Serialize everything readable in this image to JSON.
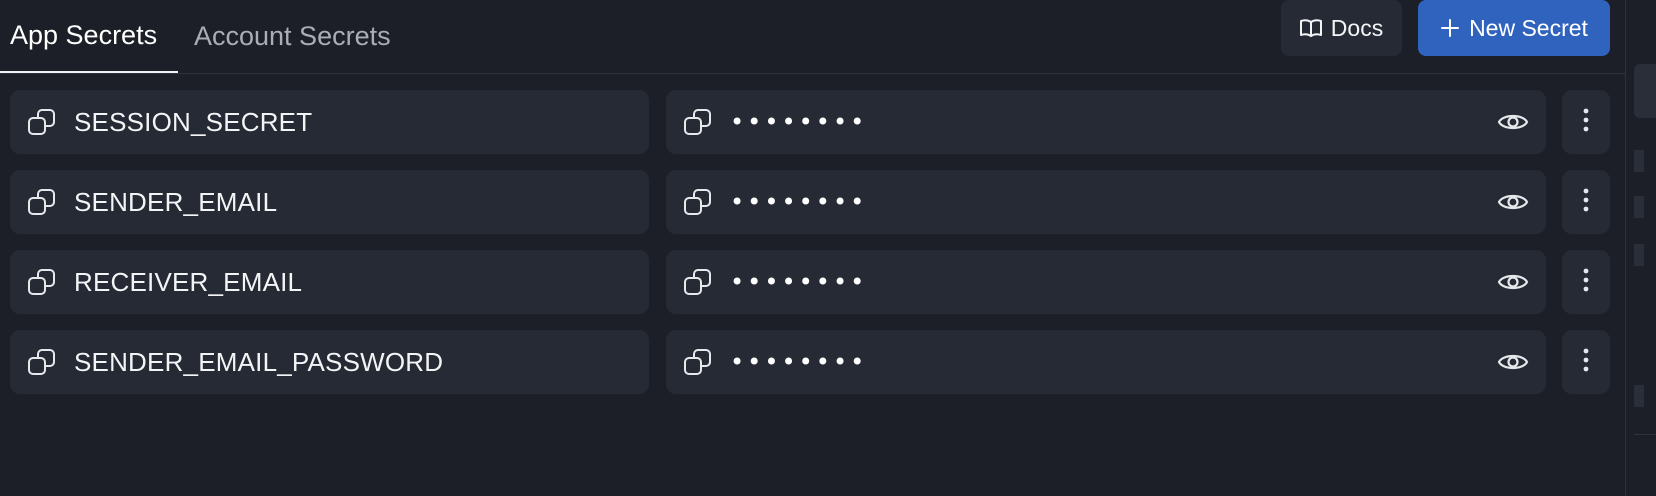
{
  "tabs": [
    {
      "label": "App Secrets",
      "active": true
    },
    {
      "label": "Account Secrets",
      "active": false
    }
  ],
  "toolbar": {
    "docs_label": "Docs",
    "docs_icon": "book-icon",
    "new_secret_label": "New Secret",
    "new_secret_icon": "plus-icon"
  },
  "secrets": [
    {
      "key": "SESSION_SECRET",
      "masked_value": "••••••••"
    },
    {
      "key": "SENDER_EMAIL",
      "masked_value": "••••••••"
    },
    {
      "key": "RECEIVER_EMAIL",
      "masked_value": "••••••••"
    },
    {
      "key": "SENDER_EMAIL_PASSWORD",
      "masked_value": "••••••••"
    }
  ],
  "colors": {
    "background": "#1c1f27",
    "row_background": "#262a34",
    "accent_button": "#2f63bd",
    "text_primary": "#f3f4f6",
    "text_inactive": "#a9adb7"
  }
}
